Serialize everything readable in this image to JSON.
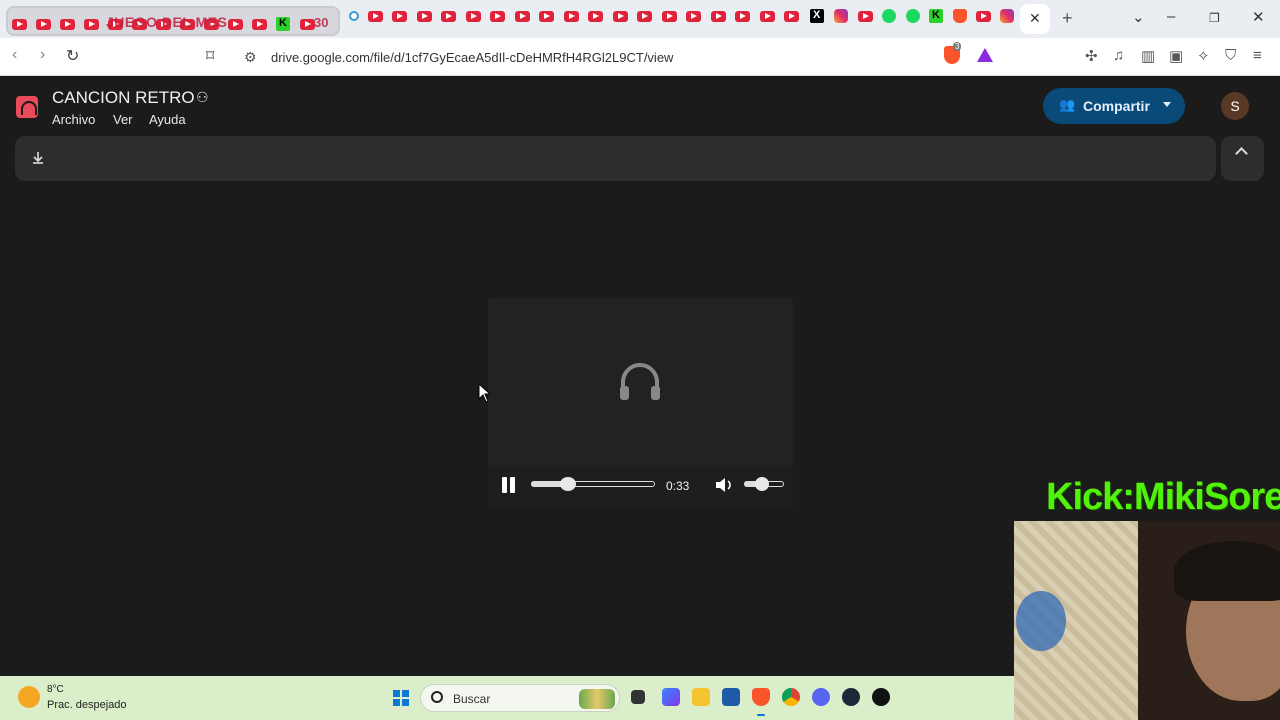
{
  "browser": {
    "tab_group_label": "JUEGO DEL MES",
    "tab_group_count": "30",
    "active_tab_close": "✕",
    "new_tab": "+",
    "url": "drive.google.com/file/d/1cf7GyEcaeA5dIl-cDeHMRfH4RGl2L9CT/view",
    "brave_shield_count": "3"
  },
  "drive": {
    "title": "CANCION RETRO",
    "menu": [
      "Archivo",
      "Ver",
      "Ayuda"
    ],
    "share_label": "Compartir",
    "avatar_initial": "S"
  },
  "player": {
    "state": "playing",
    "time": "0:33",
    "progress_fraction": 0.3,
    "volume_fraction": 0.45
  },
  "overlay": {
    "kick_text": "Kick:MikiSorel"
  },
  "taskbar": {
    "weather_temp": "8°C",
    "weather_desc": "Prac. despejado",
    "search_label": "Buscar"
  },
  "colors": {
    "page_bg": "#1b1b1b",
    "share_button": "#0a4a78",
    "kick_green": "#52f20a",
    "taskbar_bg": "#d9eec9"
  }
}
